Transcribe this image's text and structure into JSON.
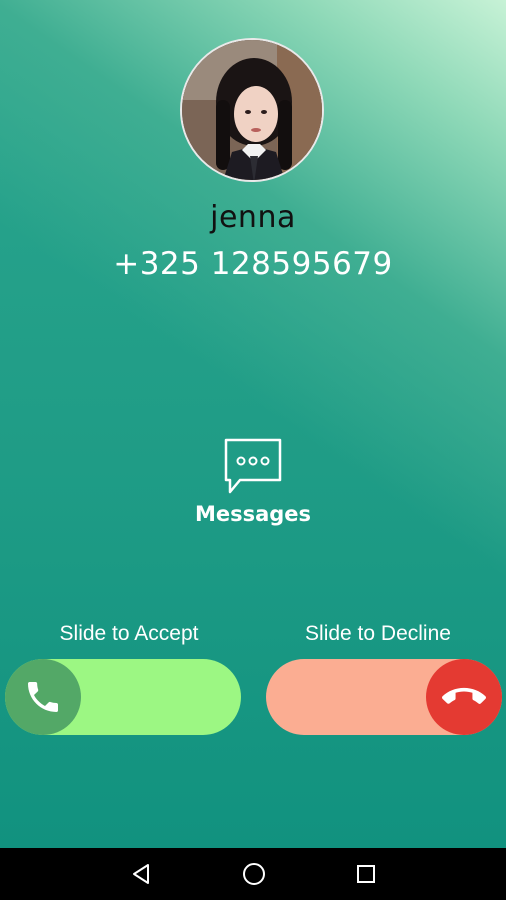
{
  "caller": {
    "name": "jenna",
    "number": "+325 128595679",
    "avatar_icon": "contact-photo"
  },
  "actions": {
    "messages_label": "Messages",
    "messages_icon": "chat-bubble-icon"
  },
  "call_controls": {
    "accept_label": "Slide to Accept",
    "decline_label": "Slide to Decline",
    "accept_icon": "phone-icon",
    "decline_icon": "phone-hangup-icon"
  },
  "colors": {
    "accept_track": "#9cf783",
    "accept_knob": "#53a867",
    "decline_track": "#fbad92",
    "decline_knob": "#e43a32",
    "background": "#1f9c86"
  },
  "nav": {
    "back_icon": "back-triangle-icon",
    "home_icon": "home-circle-icon",
    "recent_icon": "recent-apps-square-icon"
  }
}
